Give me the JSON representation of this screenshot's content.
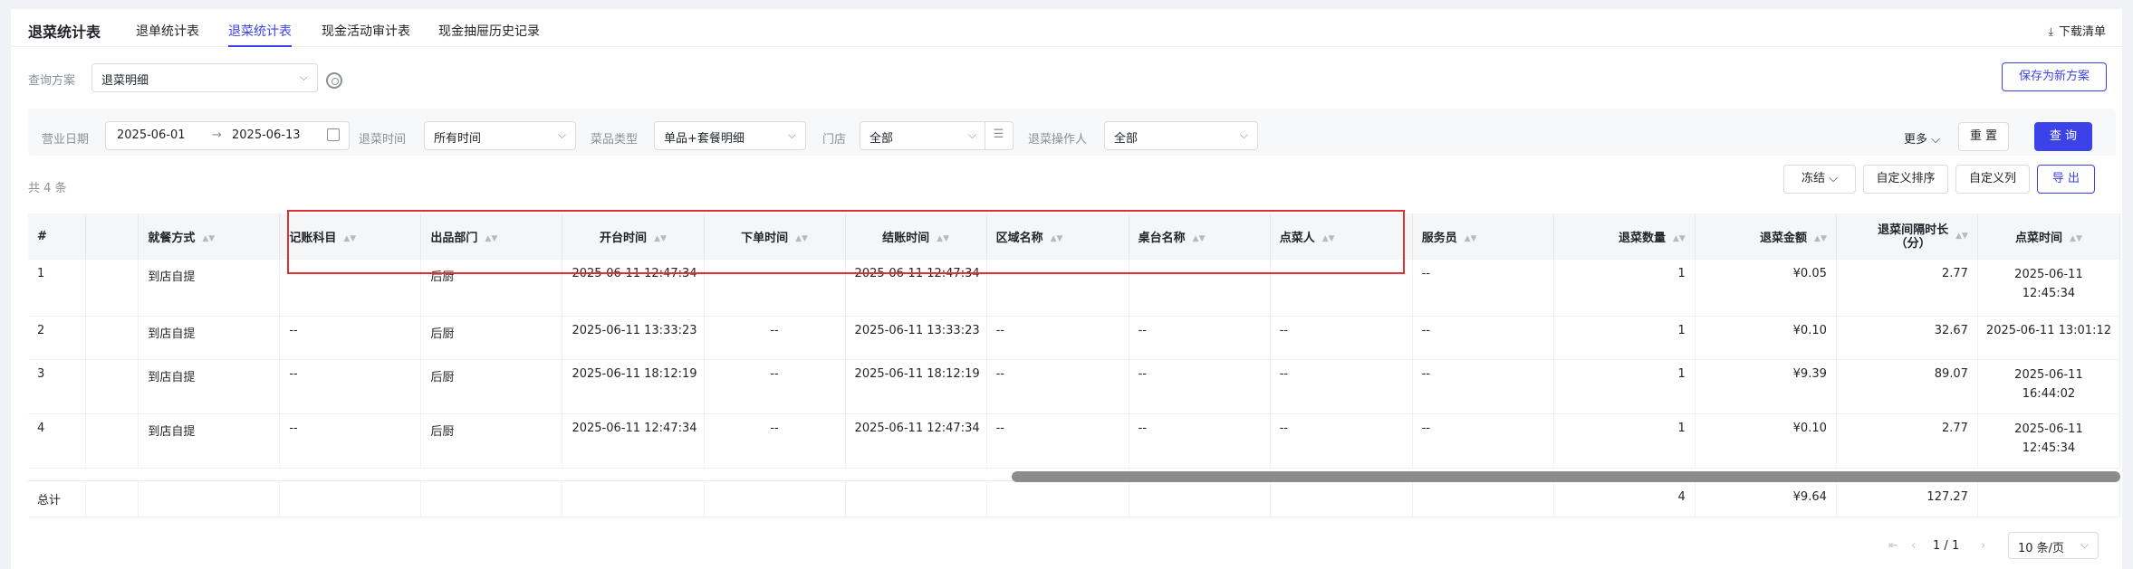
{
  "header": {
    "title": "退菜统计表",
    "tabs": [
      {
        "label": "退单统计表",
        "active": false
      },
      {
        "label": "退菜统计表",
        "active": true
      },
      {
        "label": "现金活动审计表",
        "active": false
      },
      {
        "label": "现金抽屉历史记录",
        "active": false
      }
    ],
    "download_label": "下载清单"
  },
  "scheme": {
    "label": "查询方案",
    "value": "退菜明细",
    "save_new_label": "保存为新方案"
  },
  "filters": {
    "business_date_label": "营业日期",
    "date_start": "2025-06-01",
    "date_sep": "→",
    "date_end": "2025-06-13",
    "return_time_label": "退菜时间",
    "return_time_value": "所有时间",
    "dish_type_label": "菜品类型",
    "dish_type_value": "单品+套餐明细",
    "store_label": "门店",
    "store_value": "全部",
    "operator_label": "退菜操作人",
    "operator_value": "全部",
    "more_label": "更多",
    "reset_label": "重 置",
    "query_label": "查 询"
  },
  "toolbar": {
    "total_count": "共 4 条",
    "freeze_label": "冻结",
    "custom_sort_label": "自定义排序",
    "custom_cols_label": "自定义列",
    "export_label": "导 出"
  },
  "table": {
    "columns": [
      "#",
      "",
      "就餐方式",
      "记账科目",
      "出品部门",
      "开台时间",
      "下单时间",
      "结账时间",
      "区域名称",
      "桌台名称",
      "点菜人",
      "服务员",
      "退菜数量",
      "退菜金额",
      "退菜间隔时长（分）",
      "点菜时间"
    ],
    "col_interval_line1": "退菜间隔时长",
    "col_interval_line2": "（分）",
    "rows": [
      {
        "idx": "1",
        "dine": "到店自提",
        "account": "--",
        "dept": "后厨",
        "open": "2025-06-11 12:47:34",
        "order": "--",
        "checkout": "2025-06-11 12:47:34",
        "area": "--",
        "table_name": "--",
        "orderer": "--",
        "waiter": "--",
        "qty": "1",
        "amount": "¥0.05",
        "interval": "2.77",
        "order_time_date": "2025-06-11",
        "order_time_clock": "12:45:34"
      },
      {
        "idx": "2",
        "dine": "到店自提",
        "account": "--",
        "dept": "后厨",
        "open": "2025-06-11 13:33:23",
        "order": "--",
        "checkout": "2025-06-11 13:33:23",
        "area": "--",
        "table_name": "--",
        "orderer": "--",
        "waiter": "--",
        "qty": "1",
        "amount": "¥0.10",
        "interval": "32.67",
        "order_time_full": "2025-06-11 13:01:12"
      },
      {
        "idx": "3",
        "dine": "到店自提",
        "account": "--",
        "dept": "后厨",
        "open": "2025-06-11 18:12:19",
        "order": "--",
        "checkout": "2025-06-11 18:12:19",
        "area": "--",
        "table_name": "--",
        "orderer": "--",
        "waiter": "--",
        "qty": "1",
        "amount": "¥9.39",
        "interval": "89.07",
        "order_time_date": "2025-06-11",
        "order_time_clock": "16:44:02"
      },
      {
        "idx": "4",
        "dine": "到店自提",
        "account": "--",
        "dept": "后厨",
        "open": "2025-06-11 12:47:34",
        "order": "--",
        "checkout": "2025-06-11 12:47:34",
        "area": "--",
        "table_name": "--",
        "orderer": "--",
        "waiter": "--",
        "qty": "1",
        "amount": "¥0.10",
        "interval": "2.77",
        "order_time_date": "2025-06-11",
        "order_time_clock": "12:45:34"
      }
    ],
    "total": {
      "label": "总计",
      "qty": "4",
      "amount": "¥9.64",
      "interval": "127.27"
    }
  },
  "pagination": {
    "current": "1",
    "sep": "/",
    "total_pages": "1",
    "page_size": "10 条/页"
  },
  "colors": {
    "accent": "#3b43e8",
    "highlight_box": "#e03030"
  }
}
